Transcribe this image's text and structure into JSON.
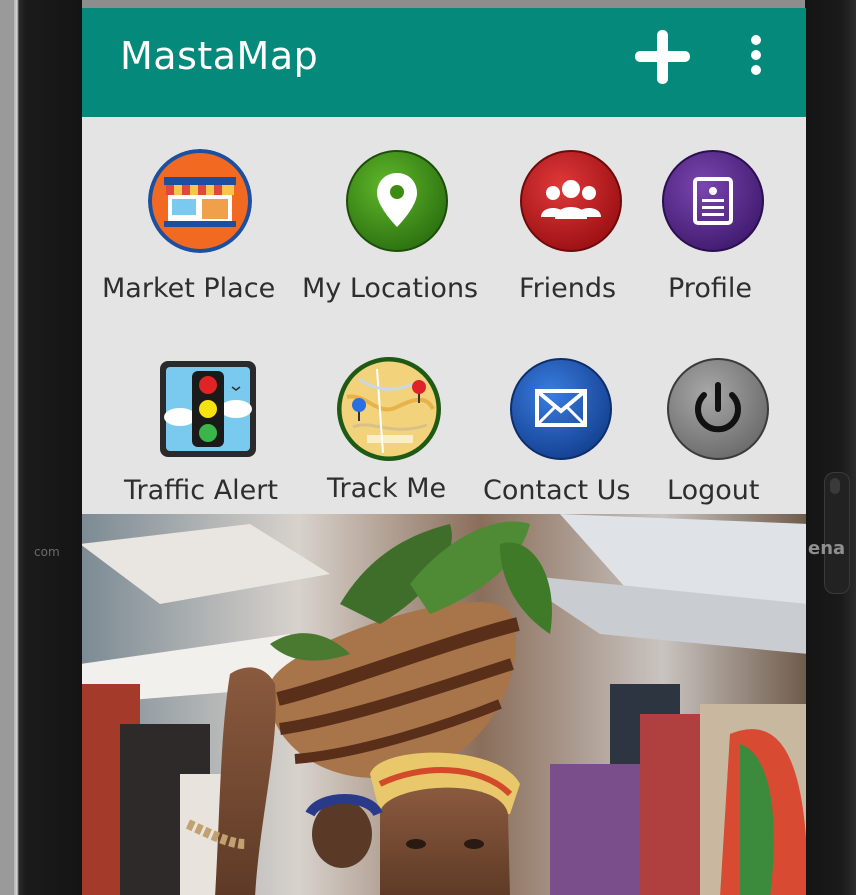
{
  "app": {
    "title": "MastaMap"
  },
  "appbar": {
    "add_icon": "plus-icon",
    "menu_icon": "overflow-menu-icon"
  },
  "menu_items": [
    {
      "label": "Market Place",
      "icon": "market-place-icon",
      "color": "#f26a21"
    },
    {
      "label": "My Locations",
      "icon": "location-pin-icon",
      "color": "#3d8c12"
    },
    {
      "label": "Friends",
      "icon": "friends-icon",
      "color": "#c0161c"
    },
    {
      "label": "Profile",
      "icon": "profile-icon",
      "color": "#5a2a8c"
    },
    {
      "label": "Traffic Alert",
      "icon": "traffic-light-icon",
      "color": "#7ac9ee"
    },
    {
      "label": "Track Me",
      "icon": "map-tracking-icon",
      "color": "#2c6e1a"
    },
    {
      "label": "Contact Us",
      "icon": "envelope-icon",
      "color": "#1f5bb8"
    },
    {
      "label": "Logout",
      "icon": "power-icon",
      "color": "#8a8a8a"
    }
  ],
  "colors": {
    "appbar": "#05897a",
    "grid_background": "#e4e4e4"
  },
  "device": {
    "side_text": "ena",
    "left_text": "com"
  }
}
